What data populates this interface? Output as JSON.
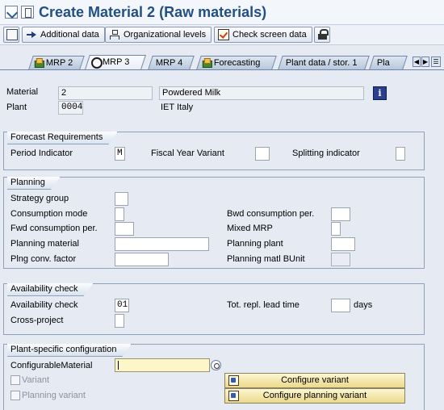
{
  "title": "Create Material 2 (Raw materials)",
  "toolbar": {
    "additional_data": "Additional data",
    "org_levels": "Organizational levels",
    "check_screen_data": "Check screen data"
  },
  "tabs": [
    {
      "label": "MRP 2",
      "icon": "green-doc-icon",
      "active": false
    },
    {
      "label": "MRP 3",
      "icon": "circle-icon",
      "active": true
    },
    {
      "label": "MRP 4",
      "icon": "",
      "active": false
    },
    {
      "label": "Forecasting",
      "icon": "green-doc-icon",
      "active": false
    },
    {
      "label": "Plant data / stor. 1",
      "icon": "",
      "active": false
    },
    {
      "label": "Pla",
      "icon": "",
      "active": false
    }
  ],
  "header": {
    "material_label": "Material",
    "material_value": "2",
    "material_desc": "Powdered Milk",
    "plant_label": "Plant",
    "plant_value": "0004",
    "plant_desc": "IET Italy"
  },
  "forecast": {
    "title": "Forecast Requirements",
    "period_indicator_label": "Period Indicator",
    "period_indicator_value": "M",
    "fiscal_year_label": "Fiscal Year Variant",
    "fiscal_year_value": "",
    "splitting_label": "Splitting indicator",
    "splitting_value": ""
  },
  "planning": {
    "title": "Planning",
    "strategy_group": "Strategy group",
    "consumption_mode": "Consumption mode",
    "fwd_consumption": "Fwd consumption per.",
    "planning_material": "Planning material",
    "plng_conv_factor": "Plng conv. factor",
    "bwd_consumption": "Bwd consumption per.",
    "mixed_mrp": "Mixed MRP",
    "planning_plant": "Planning plant",
    "planning_matl_bunit": "Planning matl BUnit"
  },
  "availability": {
    "title": "Availability check",
    "availability_check_label": "Availability check",
    "availability_check_value": "01",
    "cross_project": "Cross-project",
    "tot_repl_lead_time": "Tot. repl. lead time",
    "days": "days"
  },
  "plant_config": {
    "title": "Plant-specific configuration",
    "configurable_material": "ConfigurableMaterial",
    "configurable_material_value": "",
    "variant": "Variant",
    "planning_variant": "Planning variant",
    "configure_variant": "Configure variant",
    "configure_planning_variant": "Configure planning variant"
  }
}
